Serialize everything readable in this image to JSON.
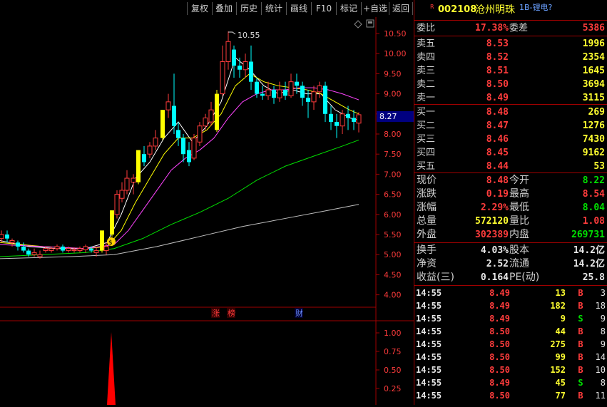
{
  "toolbar": {
    "buttons": [
      "复权",
      "叠加",
      "历史",
      "统计",
      "画线",
      "F10",
      "标记",
      "+自选",
      "返回"
    ]
  },
  "chart": {
    "peak_label": "10.55",
    "current_price_label": "8.27",
    "price_axis": [
      "10.50",
      "10.00",
      "9.50",
      "9.00",
      "8.50",
      "8.00",
      "7.50",
      "7.00",
      "6.50",
      "6.00",
      "5.50",
      "5.00",
      "4.50",
      "4.00"
    ],
    "volume_axis": [
      "1.00",
      "0.75",
      "0.50",
      "0.25"
    ],
    "event_tags": [
      "涨",
      "榜",
      "财"
    ],
    "colors": {
      "up": "#ff3c3c",
      "down": "#00ffff",
      "limit": "#ffff00",
      "ma5": "#ffffff",
      "ma10": "#ffff00",
      "ma20": "#ff44ff",
      "ma60": "#00e000",
      "ma120": "#c0c0c0"
    }
  },
  "quote": {
    "flag": "R",
    "code": "002108",
    "name": "沧州明珠",
    "sector": "1B-锂电?",
    "wei_bi_label": "委比",
    "wei_bi_value": "17.38%",
    "wei_cha_label": "委差",
    "wei_cha_value": "5386",
    "asks": [
      {
        "label": "卖五",
        "price": "8.53",
        "vol": "1996"
      },
      {
        "label": "卖四",
        "price": "8.52",
        "vol": "2354"
      },
      {
        "label": "卖三",
        "price": "8.51",
        "vol": "1645"
      },
      {
        "label": "卖二",
        "price": "8.50",
        "vol": "3694"
      },
      {
        "label": "卖一",
        "price": "8.49",
        "vol": "3115"
      }
    ],
    "bids": [
      {
        "label": "买一",
        "price": "8.48",
        "vol": "269"
      },
      {
        "label": "买二",
        "price": "8.47",
        "vol": "1276"
      },
      {
        "label": "买三",
        "price": "8.46",
        "vol": "7430"
      },
      {
        "label": "买四",
        "price": "8.45",
        "vol": "9162"
      },
      {
        "label": "买五",
        "price": "8.44",
        "vol": "53"
      }
    ],
    "stats": [
      {
        "l1": "现价",
        "v1": "8.48",
        "c1": "red",
        "l2": "今开",
        "v2": "8.22",
        "c2": "green"
      },
      {
        "l1": "涨跌",
        "v1": "0.19",
        "c1": "red",
        "l2": "最高",
        "v2": "8.54",
        "c2": "red"
      },
      {
        "l1": "涨幅",
        "v1": "2.29%",
        "c1": "red",
        "l2": "最低",
        "v2": "8.04",
        "c2": "green"
      },
      {
        "l1": "总量",
        "v1": "572120",
        "c1": "yellow",
        "l2": "量比",
        "v2": "1.08",
        "c2": "red"
      },
      {
        "l1": "外盘",
        "v1": "302389",
        "c1": "red",
        "l2": "内盘",
        "v2": "269731",
        "c2": "green"
      }
    ],
    "finance": [
      {
        "l1": "换手",
        "v1": "4.03%",
        "l2": "股本",
        "v2": "14.2亿"
      },
      {
        "l1": "净资",
        "v1": "2.52",
        "l2": "流通",
        "v2": "14.2亿"
      },
      {
        "l1": "收益(三)",
        "v1": "0.164",
        "l2": "PE(动)",
        "v2": "25.8"
      }
    ],
    "ticks": [
      {
        "time": "14:55",
        "price": "8.49",
        "vol": "13",
        "dir": "B",
        "n": "3"
      },
      {
        "time": "14:55",
        "price": "8.49",
        "vol": "182",
        "dir": "B",
        "n": "18"
      },
      {
        "time": "14:55",
        "price": "8.49",
        "vol": "9",
        "dir": "S",
        "n": "9"
      },
      {
        "time": "14:55",
        "price": "8.50",
        "vol": "44",
        "dir": "B",
        "n": "8"
      },
      {
        "time": "14:55",
        "price": "8.50",
        "vol": "275",
        "dir": "B",
        "n": "9"
      },
      {
        "time": "14:55",
        "price": "8.50",
        "vol": "99",
        "dir": "B",
        "n": "14"
      },
      {
        "time": "14:55",
        "price": "8.50",
        "vol": "152",
        "dir": "B",
        "n": "10"
      },
      {
        "time": "14:55",
        "price": "8.49",
        "vol": "45",
        "dir": "S",
        "n": "8"
      },
      {
        "time": "14:55",
        "price": "8.50",
        "vol": "77",
        "dir": "B",
        "n": "11"
      }
    ]
  }
}
